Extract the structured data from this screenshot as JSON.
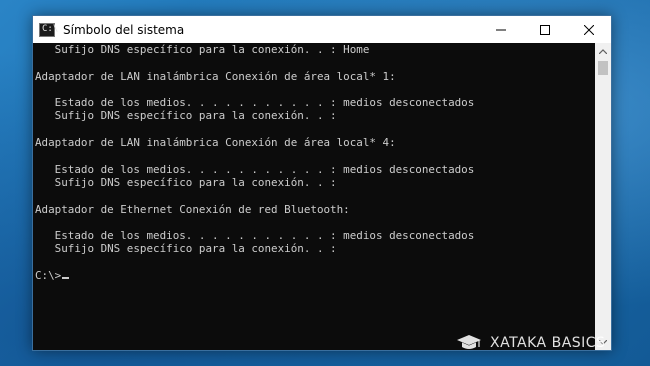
{
  "window": {
    "title": "Símbolo del sistema",
    "icon": "cmd-icon",
    "icon_glyph": "C:\\",
    "controls": {
      "minimize": "minimize-icon",
      "maximize": "maximize-icon",
      "close": "close-icon"
    }
  },
  "console": {
    "lines": [
      "   Sufijo DNS específico para la conexión. . : Home",
      "",
      "Adaptador de LAN inalámbrica Conexión de área local* 1:",
      "",
      "   Estado de los medios. . . . . . . . . . . : medios desconectados",
      "   Sufijo DNS específico para la conexión. . :",
      "",
      "Adaptador de LAN inalámbrica Conexión de área local* 4:",
      "",
      "   Estado de los medios. . . . . . . . . . . : medios desconectados",
      "   Sufijo DNS específico para la conexión. . :",
      "",
      "Adaptador de Ethernet Conexión de red Bluetooth:",
      "",
      "   Estado de los medios. . . . . . . . . . . : medios desconectados",
      "   Sufijo DNS específico para la conexión. . :",
      ""
    ],
    "prompt": "C:\\>"
  },
  "watermark": {
    "text": "XATAKA BASICS",
    "icon": "graduation-cap-icon"
  },
  "colors": {
    "console_bg": "#0c0c0c",
    "console_text": "#cccccc",
    "titlebar_bg": "#ffffff",
    "desktop": "#1a6fb0"
  }
}
